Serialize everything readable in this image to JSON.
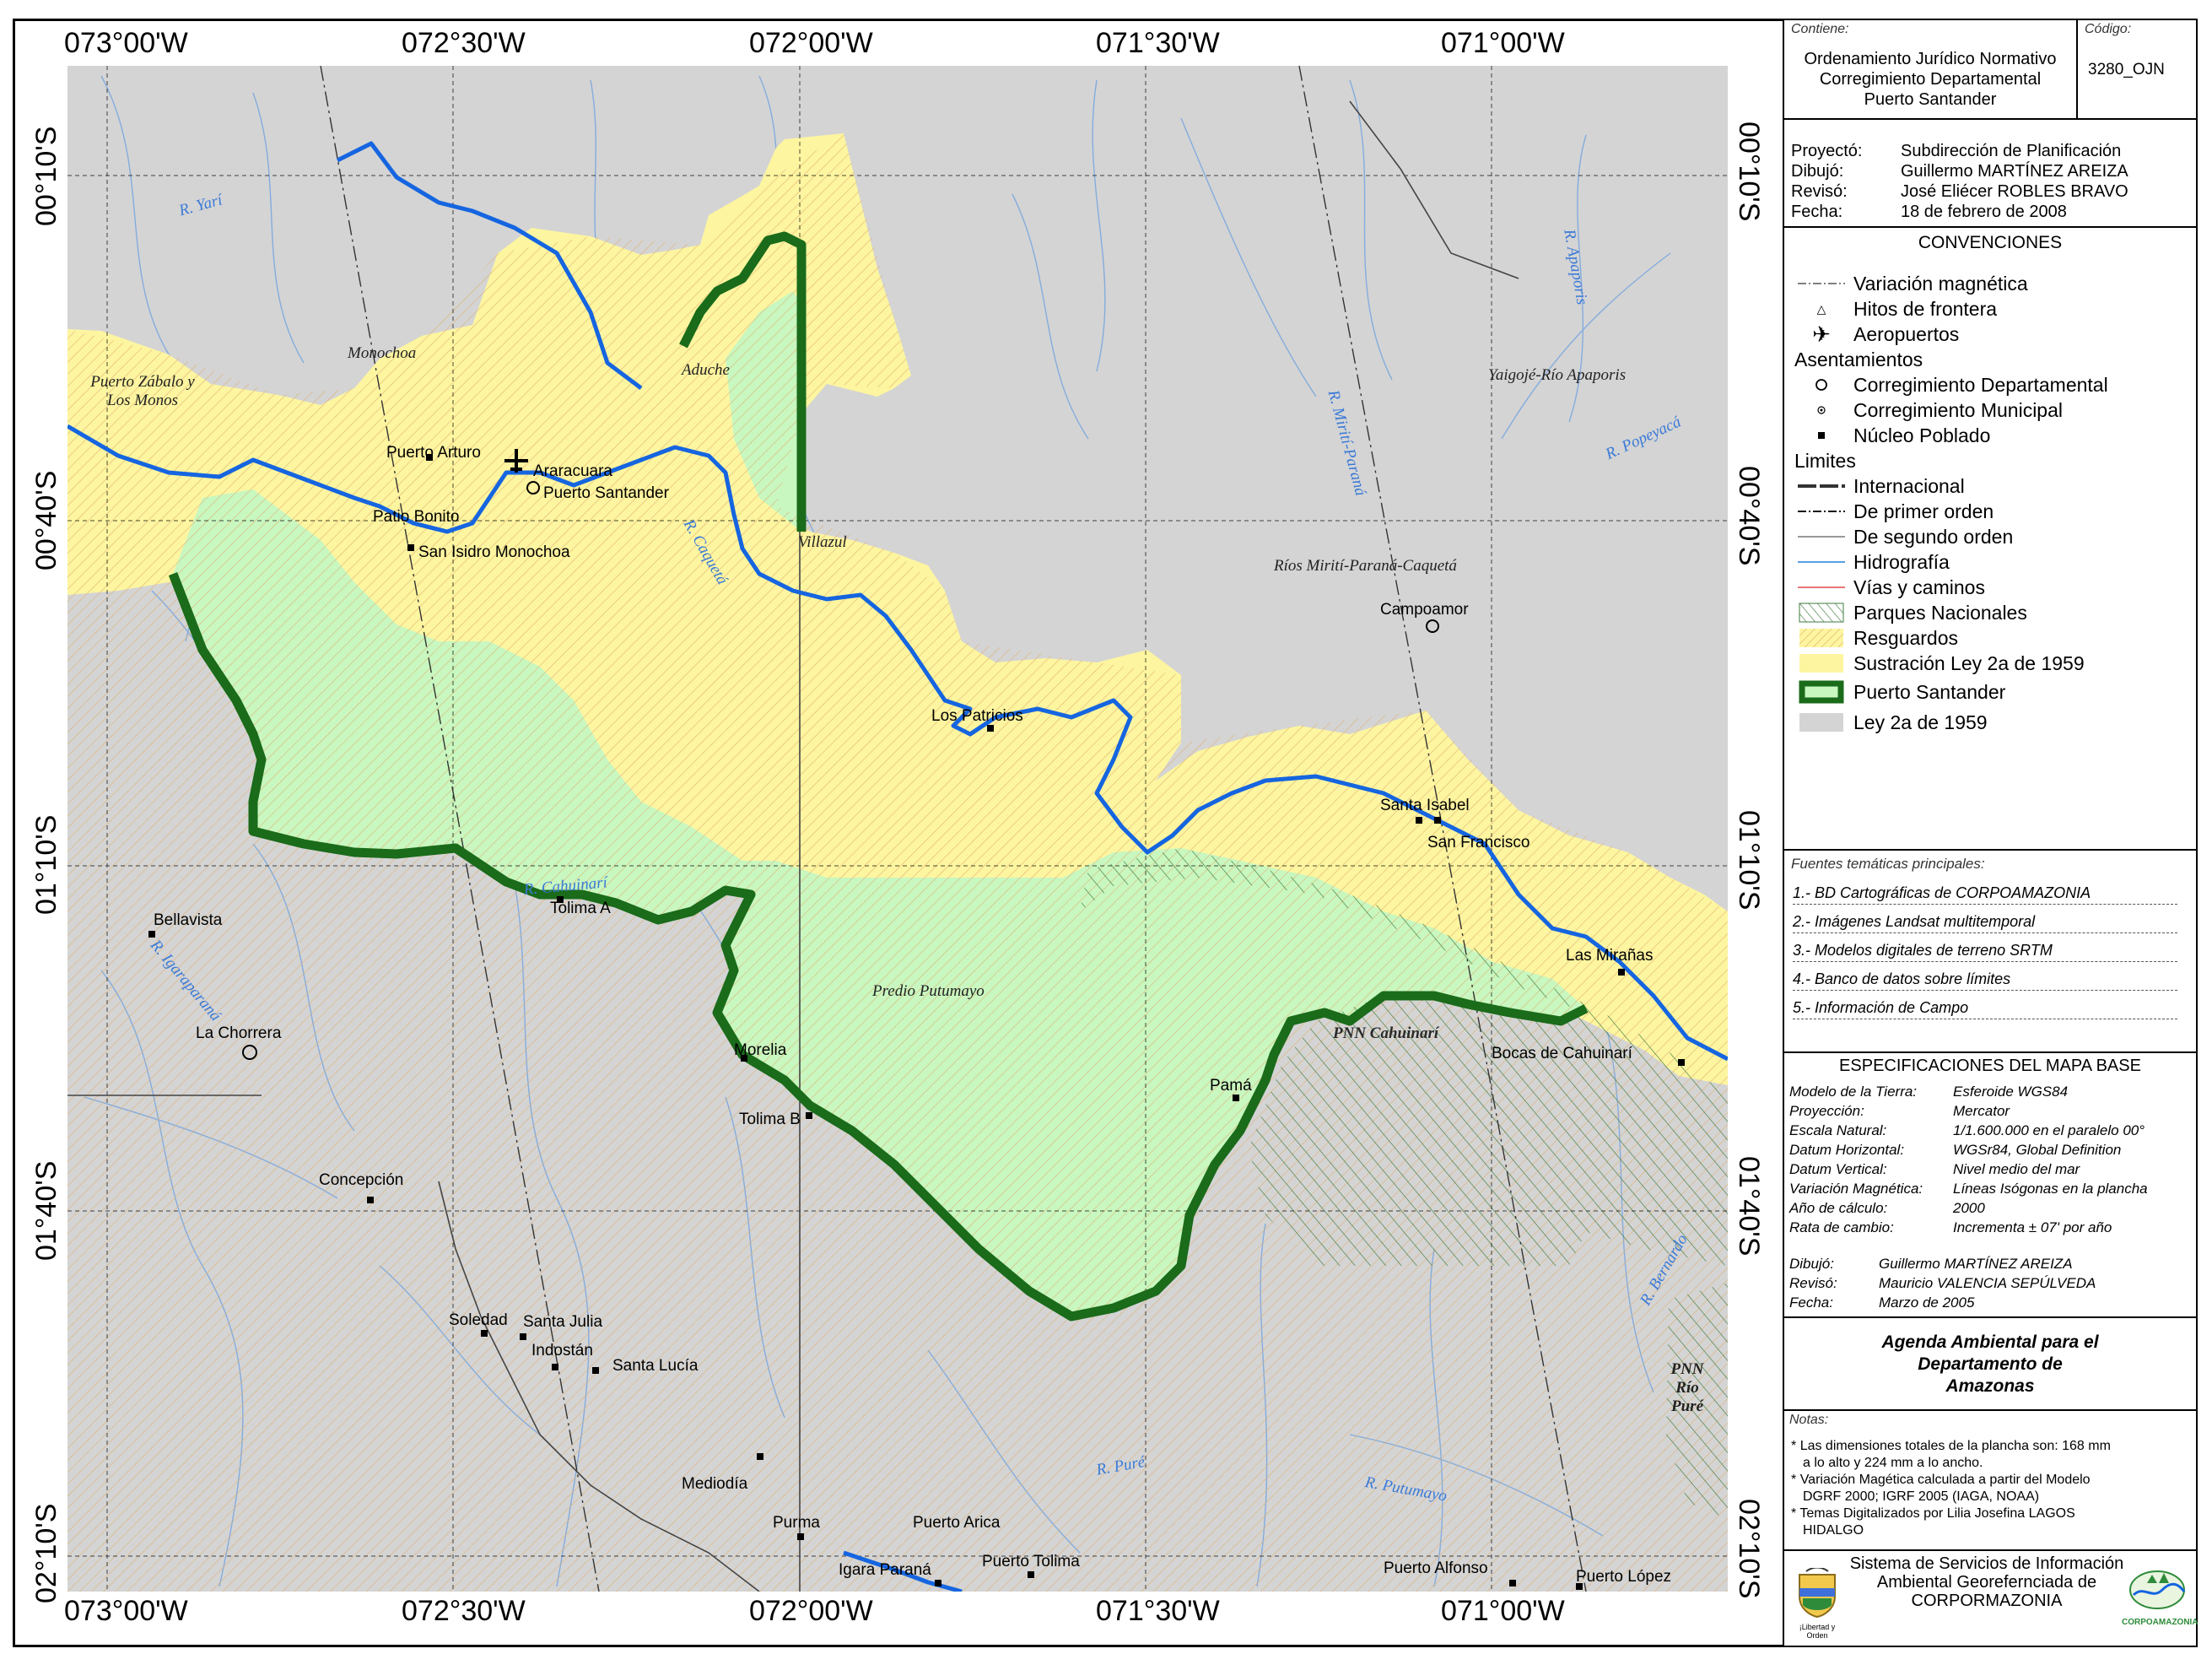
{
  "map": {
    "top_labels": [
      "073°00'W",
      "072°30'W",
      "072°00'W",
      "071°30'W",
      "071°00'W"
    ],
    "bottom_labels": [
      "073°00'W",
      "072°30'W",
      "072°00'W",
      "071°30'W",
      "071°00'W"
    ],
    "left_labels": [
      "00°10'S",
      "00°40'S",
      "01°10'S",
      "01°40'S",
      "02°10'S"
    ],
    "right_labels": [
      "00°10'S",
      "00°40'S",
      "01°10'S",
      "01°40'S",
      "02°10'S"
    ],
    "places": [
      "Puerto Arturo",
      "Araracuara",
      "Puerto Santander",
      "Patio Bonito",
      "San Isidro Monochoa",
      "Campoamor",
      "Los Patricios",
      "Santa Isabel",
      "San Francisco",
      "Las Mirañas",
      "Bocas de Cahuinarí",
      "Pamá",
      "Tolima A",
      "Morelia",
      "Tolima B",
      "Bellavista",
      "La Chorrera",
      "Concepción",
      "Soledad",
      "Santa Julia",
      "Indostán",
      "Santa Lucía",
      "Mediodía",
      "Puerto Arica",
      "Purma",
      "Igara Paraná",
      "Puerto Tolima",
      "Puerto Alfonso",
      "Puerto López"
    ],
    "areas": [
      "Monochoa",
      "Puerto Zábalo y Los Monos",
      "Aduche",
      "Villazul",
      "Yaigojé-Río Apaporis",
      "Ríos Mirití-Paraná-Caquetá",
      "Predio Putumayo",
      "PNN Cahuinarí",
      "PNN Río Puré"
    ],
    "rivers": [
      "R. Yarí",
      "R. Caquetá",
      "R. Cahuinarí",
      "R. Igaraparaná",
      "R. Putumayo",
      "R. Apaporis",
      "R. Popeyacá",
      "R. Mirití-Paraná",
      "R. Puré",
      "R. Bernardo"
    ],
    "colors": {
      "background": "#d3d3d3",
      "ley2": "#fdf5a0",
      "puerto_santander": "#c8f5c0",
      "border": "#1a6b1a",
      "river": "#1565e0",
      "hydro": "#6a9fe0"
    }
  },
  "panel": {
    "contains_label": "Contiene:",
    "code_label": "Código:",
    "title_lines": [
      "Ordenamiento Jurídico Normativo",
      "Corregimiento Departamental",
      "Puerto Santander"
    ],
    "code": "3280_OJN",
    "project": [
      {
        "k": "Proyectó:",
        "v": "Subdirección de Planificación"
      },
      {
        "k": "Dibujó:",
        "v": "Guillermo MARTÍNEZ AREIZA"
      },
      {
        "k": "Revisó:",
        "v": "José Eliécer ROBLES BRAVO"
      },
      {
        "k": "Fecha:",
        "v": "18 de febrero de 2008"
      }
    ],
    "legend_title": "CONVENCIONES",
    "legend": [
      "Variación magnética",
      "Hitos de frontera",
      "Aeropuertos",
      "Asentamientos",
      "Corregimiento Departamental",
      "Corregimiento Municipal",
      "Núcleo Poblado",
      "Limites",
      "Internacional",
      "De primer orden",
      "De segundo orden",
      "Hidrografía",
      "Vías y caminos",
      "Parques Nacionales",
      "Resguardos",
      "Sustración Ley 2a de 1959",
      "Puerto Santander",
      "Ley 2a de 1959"
    ],
    "sources_title": "Fuentes temáticas principales:",
    "sources": [
      "1.- BD Cartográficas de CORPOAMAZONIA",
      "2.- Imágenes Landsat multitemporal",
      "3.- Modelos digitales de terreno SRTM",
      "4.- Banco de datos sobre límites",
      "5.- Información de Campo"
    ],
    "spec_title": "ESPECIFICACIONES DEL MAPA BASE",
    "specs": [
      {
        "k": "Modelo de la Tierra:",
        "v": "Esferoide WGS84"
      },
      {
        "k": "Proyección:",
        "v": "Mercator"
      },
      {
        "k": "Escala Natural:",
        "v": "1/1.600.000 en el paralelo 00°"
      },
      {
        "k": "Datum Horizontal:",
        "v": "WGSr84, Global Definition"
      },
      {
        "k": "Datum Vertical:",
        "v": "Nivel medio del mar"
      },
      {
        "k": "Variación Magnética:",
        "v": "Líneas Isógonas en la plancha"
      },
      {
        "k": "Año de cálculo:",
        "v": "2000"
      },
      {
        "k": "Rata de cambio:",
        "v": "Incrementa ± 07' por año"
      }
    ],
    "spec_credits": [
      {
        "k": "Dibujó:",
        "v": "Guillermo MARTÍNEZ AREIZA"
      },
      {
        "k": "Revisó:",
        "v": "Mauricio VALENCIA SEPÚLVEDA"
      },
      {
        "k": "Fecha:",
        "v": "Marzo de 2005"
      }
    ],
    "agenda_lines": [
      "Agenda Ambiental para el",
      "Departamento de",
      "Amazonas"
    ],
    "notes_title": "Notas:",
    "notes": [
      "Las dimensiones totales de la plancha son: 168 mm",
      "a lo alto y 224 mm a lo ancho.",
      "Variación Magética calculada a partir del Modelo",
      "DGRF 2000; IGRF 2005 (IAGA, NOAA)",
      "Temas Digitalizados por Lilia Josefina LAGOS",
      "HIDALGO"
    ],
    "footer_lines": [
      "Sistema de Servicios de Información",
      "Ambiental Georefernciada de",
      "CORPORMAZONIA"
    ],
    "logo_left_caption": "¡Libertad y Orden",
    "logo_right_caption": "CORPOAMAZONIA"
  }
}
